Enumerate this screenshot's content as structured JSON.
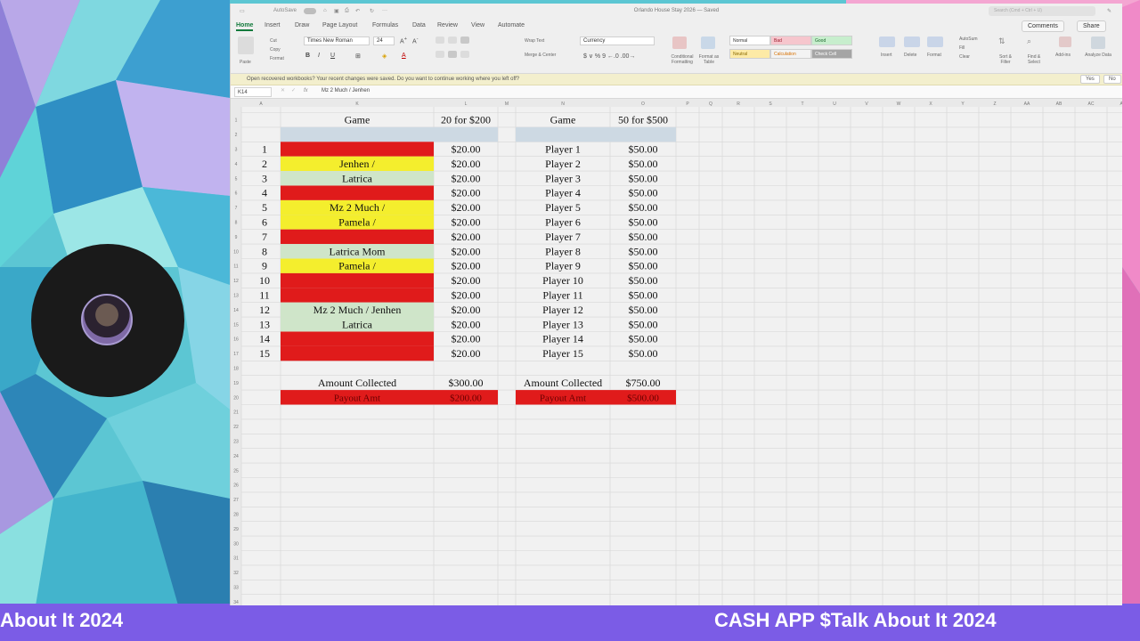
{
  "excel": {
    "doc_title": "Orlando House Stay 2026 — Saved",
    "autosave_label": "AutoSave",
    "search_placeholder": "Search (Cmd + Ctrl + U)",
    "tabs": [
      "Home",
      "Insert",
      "Draw",
      "Page Layout",
      "Formulas",
      "Data",
      "Review",
      "View",
      "Automate"
    ],
    "comments_label": "Comments",
    "share_label": "Share",
    "ribbon": {
      "paste": "Paste",
      "cut": "Cut",
      "copy": "Copy",
      "format": "Format",
      "font_name": "Times New Roman",
      "font_size": "24",
      "wrap_text": "Wrap Text",
      "merge_center": "Merge & Center",
      "number_format": "Currency",
      "conditional_formatting": "Conditional Formatting",
      "format_as_table": "Format as Table",
      "styles": [
        {
          "label": "Normal",
          "bg": "#ffffff",
          "fg": "#333333"
        },
        {
          "label": "Bad",
          "bg": "#f6c6cd",
          "fg": "#9c1b2d"
        },
        {
          "label": "Good",
          "bg": "#c7eecd",
          "fg": "#1e6a2e"
        },
        {
          "label": "Neutral",
          "bg": "#fdeaa6",
          "fg": "#8a6a00"
        },
        {
          "label": "Calculation",
          "bg": "#f3f3f3",
          "fg": "#d77000"
        },
        {
          "label": "Check Cell",
          "bg": "#a5a5a5",
          "fg": "#ffffff"
        }
      ],
      "insert": "Insert",
      "delete": "Delete",
      "format_cells": "Format",
      "autosum": "AutoSum",
      "fill": "Fill",
      "clear": "Clear",
      "sort_filter": "Sort & Filter",
      "find_select": "Find & Select",
      "addins": "Add-ins",
      "analyze_data": "Analyze Data"
    },
    "message": "Open recovered workbooks?  Your recent changes were saved. Do you want to continue working where you left off?",
    "message_yes": "Yes",
    "message_no": "No",
    "name_box": "K14",
    "formula": "Mz 2 Much / Jenhen",
    "fx": "fx",
    "columns": [
      "A",
      "K",
      "L",
      "M",
      "N",
      "O",
      "P",
      "Q",
      "R",
      "S",
      "T",
      "U",
      "V",
      "W",
      "X",
      "Y",
      "Z",
      "AA",
      "AB",
      "AC",
      "AD"
    ],
    "row_numbers": [
      "1",
      "2",
      "3",
      "4",
      "5",
      "6",
      "7",
      "8",
      "9",
      "10",
      "11",
      "12",
      "13",
      "14",
      "15",
      "16",
      "17",
      "18",
      "19",
      "20",
      "21",
      "22",
      "23",
      "24",
      "25",
      "26",
      "27",
      "28",
      "29",
      "30",
      "31",
      "32",
      "33",
      "34"
    ],
    "colors": {
      "red": "#e01b1b",
      "yellow": "#f4ee2d",
      "green": "#cfe5c9",
      "header_blue": "#cdd9e3",
      "grid": "#d6d6d6"
    },
    "table1": {
      "header_game": "Game",
      "header_price": "20 for $200",
      "rows": [
        {
          "num": "1",
          "name": "",
          "fill": "red",
          "amount": "$20.00"
        },
        {
          "num": "2",
          "name": "Jenhen /",
          "fill": "yellow",
          "amount": "$20.00"
        },
        {
          "num": "3",
          "name": "Latrica",
          "fill": "green",
          "amount": "$20.00"
        },
        {
          "num": "4",
          "name": "",
          "fill": "red",
          "amount": "$20.00"
        },
        {
          "num": "5",
          "name": "Mz 2 Much /",
          "fill": "yellow",
          "amount": "$20.00"
        },
        {
          "num": "6",
          "name": "Pamela /",
          "fill": "yellow",
          "amount": "$20.00"
        },
        {
          "num": "7",
          "name": "",
          "fill": "red",
          "amount": "$20.00"
        },
        {
          "num": "8",
          "name": "Latrica Mom",
          "fill": "green",
          "amount": "$20.00"
        },
        {
          "num": "9",
          "name": "Pamela /",
          "fill": "yellow",
          "amount": "$20.00"
        },
        {
          "num": "10",
          "name": "",
          "fill": "red",
          "amount": "$20.00"
        },
        {
          "num": "11",
          "name": "",
          "fill": "red",
          "amount": "$20.00"
        },
        {
          "num": "12",
          "name": "Mz 2 Much / Jenhen",
          "fill": "green",
          "amount": "$20.00"
        },
        {
          "num": "13",
          "name": "Latrica",
          "fill": "green",
          "amount": "$20.00"
        },
        {
          "num": "14",
          "name": "",
          "fill": "red",
          "amount": "$20.00"
        },
        {
          "num": "15",
          "name": "",
          "fill": "red",
          "amount": "$20.00"
        }
      ],
      "collected_label": "Amount Collected",
      "collected_value": "$300.00",
      "payout_label": "Payout Amt",
      "payout_value": "$200.00"
    },
    "table2": {
      "header_game": "Game",
      "header_price": "50 for $500",
      "rows": [
        {
          "name": "Player 1",
          "amount": "$50.00"
        },
        {
          "name": "Player 2",
          "amount": "$50.00"
        },
        {
          "name": "Player 3",
          "amount": "$50.00"
        },
        {
          "name": "Player 4",
          "amount": "$50.00"
        },
        {
          "name": "Player 5",
          "amount": "$50.00"
        },
        {
          "name": "Player 6",
          "amount": "$50.00"
        },
        {
          "name": "Player 7",
          "amount": "$50.00"
        },
        {
          "name": "Player 8",
          "amount": "$50.00"
        },
        {
          "name": "Player 9",
          "amount": "$50.00"
        },
        {
          "name": "Player 10",
          "amount": "$50.00"
        },
        {
          "name": "Player 11",
          "amount": "$50.00"
        },
        {
          "name": "Player 12",
          "amount": "$50.00"
        },
        {
          "name": "Player 13",
          "amount": "$50.00"
        },
        {
          "name": "Player 14",
          "amount": "$50.00"
        },
        {
          "name": "Player 15",
          "amount": "$50.00"
        }
      ],
      "collected_label": "Amount Collected",
      "collected_value": "$750.00",
      "payout_label": "Payout Amt",
      "payout_value": "$500.00"
    }
  },
  "ticker": {
    "left_text": "About It 2024",
    "right_text": "CASH APP $Talk About It 2024",
    "bg": "#7b5ce6"
  }
}
